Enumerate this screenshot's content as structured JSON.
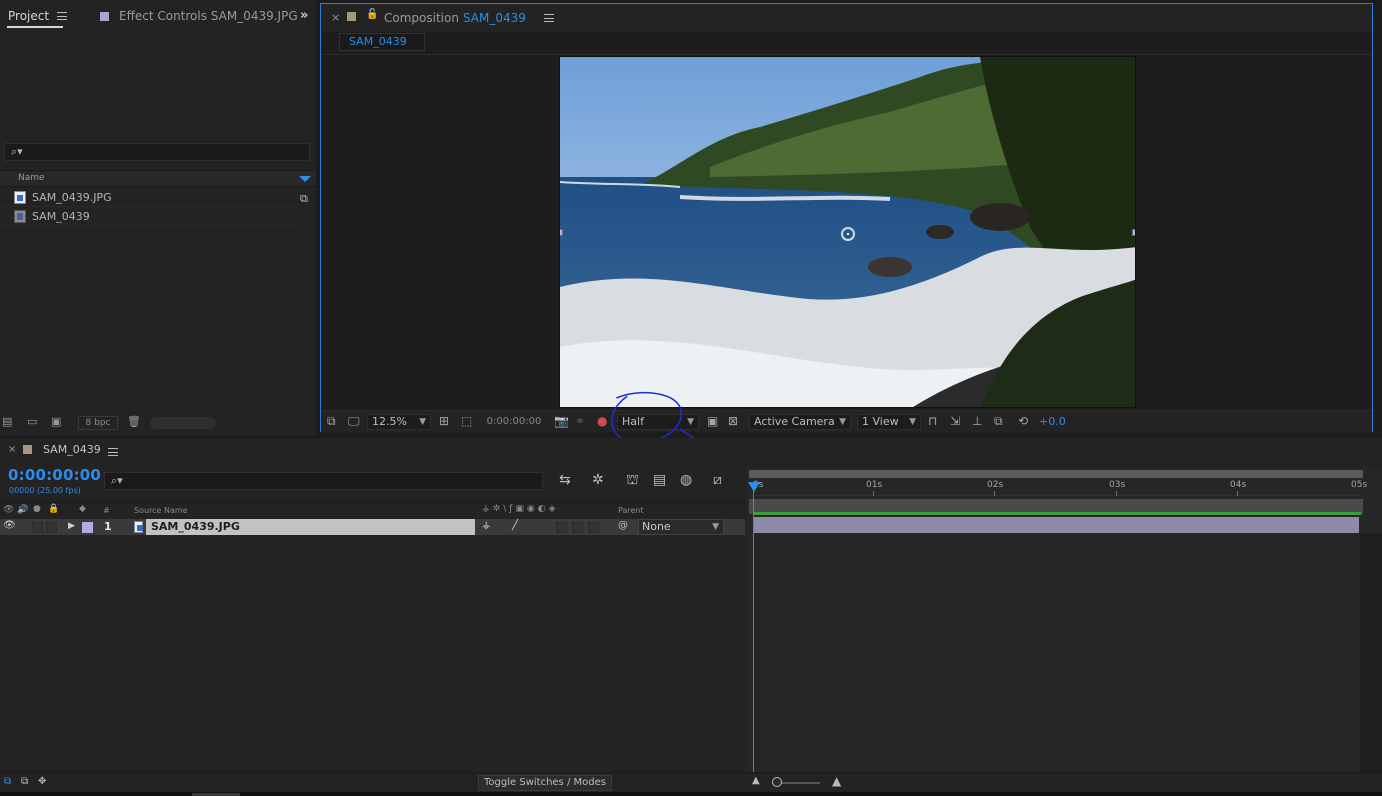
{
  "project_panel": {
    "tabs": [
      {
        "label": "Project"
      },
      {
        "label": "Effect Controls SAM_0439.JPG"
      }
    ],
    "search": {
      "placeholder": ""
    },
    "column_header": "Name",
    "items": [
      {
        "name": "SAM_0439.JPG",
        "icon": "image-file-icon"
      },
      {
        "name": "SAM_0439",
        "icon": "composition-icon"
      }
    ],
    "footer": {
      "bpc": "8 bpc"
    }
  },
  "composition_panel": {
    "title_prefix": "Composition",
    "title_name": "SAM_0439",
    "subtab": "SAM_0439",
    "toolbar": {
      "zoom": "12.5%",
      "timecode": "0:00:00:00",
      "resolution": "Half",
      "camera": "Active Camera",
      "views": "1 View",
      "exposure": "+0.0"
    }
  },
  "timeline": {
    "tab_title": "SAM_0439",
    "timecode": "0:00:00:00",
    "fps": "00000 (25.00 fps)",
    "columns": {
      "num": "#",
      "source": "Source Name",
      "parent": "Parent"
    },
    "layers": [
      {
        "num": "1",
        "name": "SAM_0439.JPG",
        "parent": "None"
      }
    ],
    "ruler": [
      "0s",
      "01s",
      "02s",
      "03s",
      "04s",
      "05s"
    ],
    "toggle_label": "Toggle Switches / Modes"
  },
  "colors": {
    "accent": "#2d8ceb",
    "layer_bar": "#8e8aaa",
    "annotation": "#1a2fd6"
  }
}
